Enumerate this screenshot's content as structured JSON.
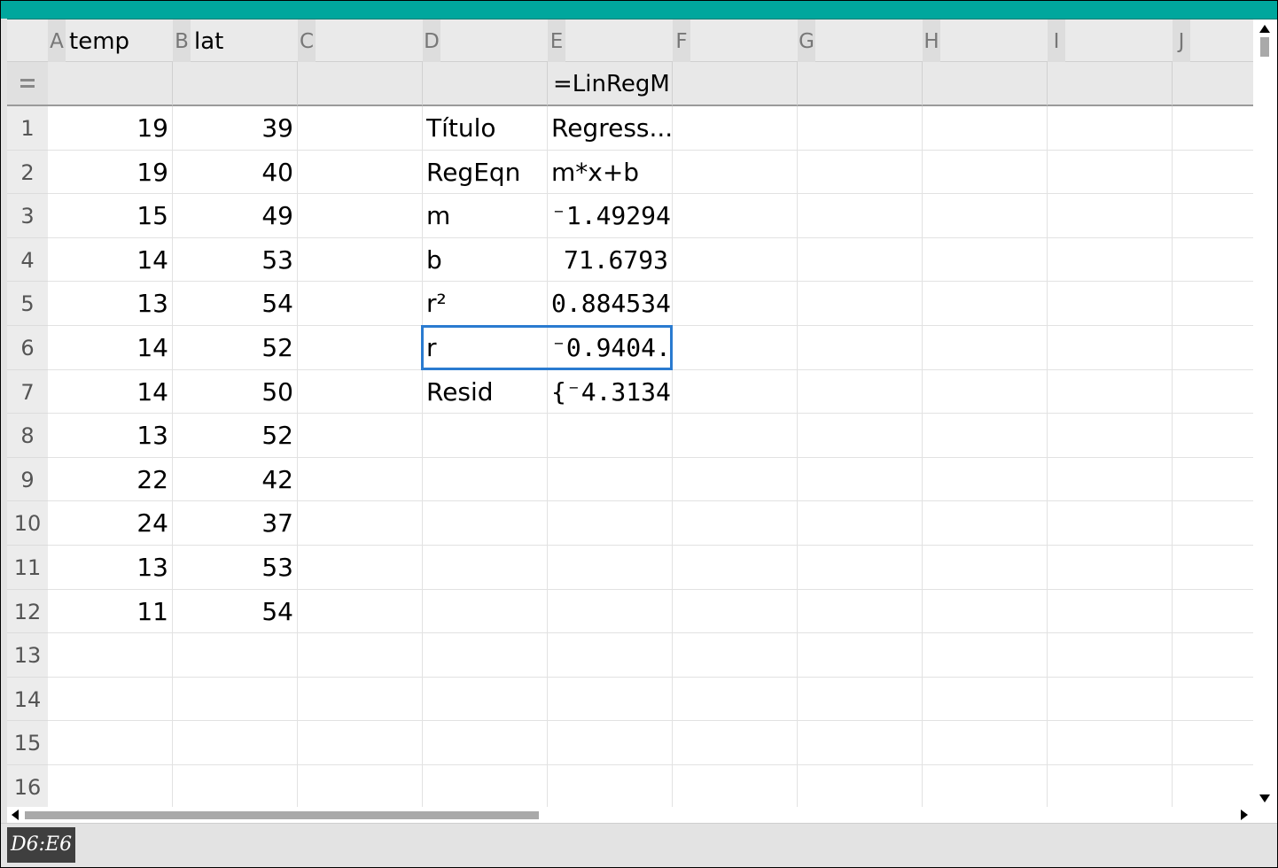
{
  "columns": [
    {
      "letter": "A",
      "name": "temp",
      "formula": ""
    },
    {
      "letter": "B",
      "name": "lat",
      "formula": ""
    },
    {
      "letter": "C",
      "name": "",
      "formula": ""
    },
    {
      "letter": "D",
      "name": "",
      "formula": ""
    },
    {
      "letter": "E",
      "name": "",
      "formula": "=LinRegM"
    },
    {
      "letter": "F",
      "name": "",
      "formula": ""
    },
    {
      "letter": "G",
      "name": "",
      "formula": ""
    },
    {
      "letter": "H",
      "name": "",
      "formula": ""
    },
    {
      "letter": "I",
      "name": "",
      "formula": ""
    },
    {
      "letter": "J",
      "name": "",
      "formula": ""
    }
  ],
  "rows": [
    {
      "n": "1",
      "A": "19",
      "B": "39",
      "D": "Título",
      "E": "Regress..."
    },
    {
      "n": "2",
      "A": "19",
      "B": "40",
      "D": "RegEqn",
      "E": "m*x+b"
    },
    {
      "n": "3",
      "A": "15",
      "B": "49",
      "D": "m",
      "E": "⁻1.49294"
    },
    {
      "n": "4",
      "A": "14",
      "B": "53",
      "D": "b",
      "E": "71.6793"
    },
    {
      "n": "5",
      "A": "13",
      "B": "54",
      "D": "r²",
      "E": "0.884534"
    },
    {
      "n": "6",
      "A": "14",
      "B": "52",
      "D": "r",
      "E": "⁻0.9404..."
    },
    {
      "n": "7",
      "A": "14",
      "B": "50",
      "D": "Resid",
      "E": "{⁻4.3134..."
    },
    {
      "n": "8",
      "A": "13",
      "B": "52",
      "D": "",
      "E": ""
    },
    {
      "n": "9",
      "A": "22",
      "B": "42",
      "D": "",
      "E": ""
    },
    {
      "n": "10",
      "A": "24",
      "B": "37",
      "D": "",
      "E": ""
    },
    {
      "n": "11",
      "A": "13",
      "B": "53",
      "D": "",
      "E": ""
    },
    {
      "n": "12",
      "A": "11",
      "B": "54",
      "D": "",
      "E": ""
    },
    {
      "n": "13",
      "A": "",
      "B": "",
      "D": "",
      "E": ""
    },
    {
      "n": "14",
      "A": "",
      "B": "",
      "D": "",
      "E": ""
    },
    {
      "n": "15",
      "A": "",
      "B": "",
      "D": "",
      "E": ""
    },
    {
      "n": "16",
      "A": "",
      "B": "",
      "D": "",
      "E": ""
    }
  ],
  "status": {
    "selection": "D6:E6"
  },
  "colors": {
    "title_bar": "#00a79d",
    "selection": "#2a7bd0"
  }
}
